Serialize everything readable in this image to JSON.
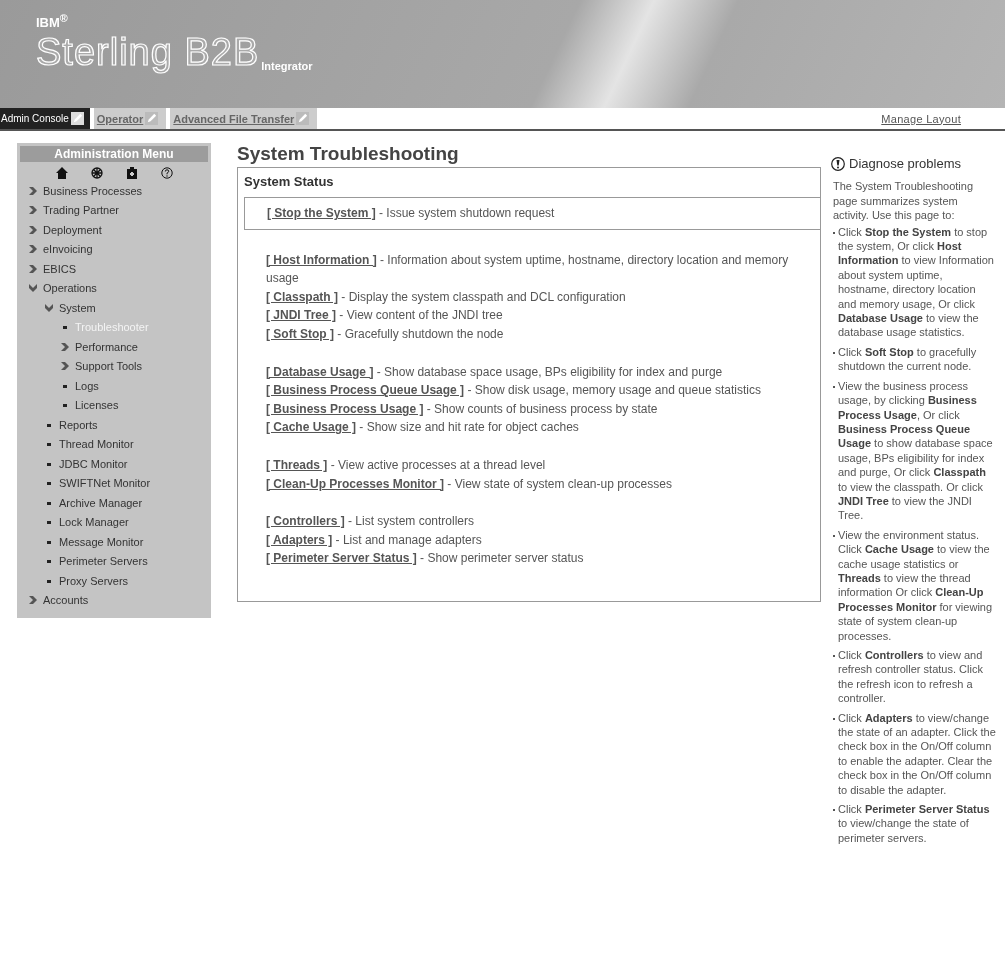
{
  "header": {
    "company": "IBM$^{®}$",
    "product": "Sterling B2B",
    "subtitle": "Integrator"
  },
  "tabs": [
    {
      "label": "Admin Console",
      "selected": true
    },
    {
      "label": "Operator",
      "selected": false
    },
    {
      "label": "Advanced File Transfer",
      "selected": false
    }
  ],
  "manage_layout": "Manage Layout",
  "sidebar": {
    "title": "Administration Menu",
    "items": [
      {
        "label": "Business Processes",
        "kind": "folder",
        "expanded": false,
        "selected": false
      },
      {
        "label": "Trading Partner",
        "kind": "folder",
        "expanded": false,
        "selected": false
      },
      {
        "label": "Deployment",
        "kind": "folder",
        "expanded": false,
        "selected": false
      },
      {
        "label": "eInvoicing",
        "kind": "folder",
        "expanded": false,
        "selected": false
      },
      {
        "label": "EBICS",
        "kind": "folder",
        "expanded": false,
        "selected": false
      },
      {
        "label": "Operations",
        "kind": "folder",
        "expanded": true,
        "selected": false,
        "children": [
          {
            "label": "System",
            "kind": "folder",
            "expanded": true,
            "selected": false,
            "children": [
              {
                "label": "Troubleshooter",
                "kind": "leaf",
                "selected": true
              },
              {
                "label": "Performance",
                "kind": "folder",
                "expanded": false,
                "selected": false
              },
              {
                "label": "Support Tools",
                "kind": "folder",
                "expanded": false,
                "selected": false
              },
              {
                "label": "Logs",
                "kind": "leaf",
                "selected": false
              },
              {
                "label": "Licenses",
                "kind": "leaf",
                "selected": false
              }
            ]
          },
          {
            "label": "Reports",
            "kind": "leaf",
            "selected": false
          },
          {
            "label": "Thread Monitor",
            "kind": "leaf",
            "selected": false
          },
          {
            "label": "JDBC Monitor",
            "kind": "leaf",
            "selected": false
          },
          {
            "label": "SWIFTNet Monitor",
            "kind": "leaf",
            "selected": false
          },
          {
            "label": "Archive Manager",
            "kind": "leaf",
            "selected": false
          },
          {
            "label": "Lock Manager",
            "kind": "leaf",
            "selected": false
          },
          {
            "label": "Message Monitor",
            "kind": "leaf",
            "selected": false
          },
          {
            "label": "Perimeter Servers",
            "kind": "leaf",
            "selected": false
          },
          {
            "label": "Proxy Servers",
            "kind": "leaf",
            "selected": false
          }
        ]
      },
      {
        "label": "Accounts",
        "kind": "folder",
        "expanded": false,
        "selected": false
      }
    ]
  },
  "page_title": "System Troubleshooting",
  "panel": {
    "title": "System Status",
    "groups": [
      {
        "framed": true,
        "links": [
          {
            "link": "[ Stop the System ]",
            "text": "- Issue system shutdown request"
          }
        ]
      },
      {
        "framed": false,
        "links": [
          {
            "link": "[ Host Information ]",
            "text": "- Information about system uptime, hostname, directory location and memory usage"
          },
          {
            "link": "[ Classpath ]",
            "text": "- Display the system classpath and DCL configuration"
          },
          {
            "link": "[ JNDI Tree ]",
            "text": "- View content of the JNDI tree"
          },
          {
            "link": "[ Soft Stop ]",
            "text": "- Gracefully shutdown the node"
          }
        ]
      },
      {
        "framed": false,
        "links": [
          {
            "link": "[ Database Usage ]",
            "text": "- Show database space usage, BPs eligibility for index and purge"
          },
          {
            "link": "[ Business Process Queue Usage ]",
            "text": "- Show disk usage, memory usage and queue statistics"
          },
          {
            "link": "[ Business Process Usage ]",
            "text": "- Show counts of business process by state"
          },
          {
            "link": "[ Cache Usage ]",
            "text": "- Show size and hit rate for object caches"
          }
        ]
      },
      {
        "framed": false,
        "links": [
          {
            "link": "[ Threads ]",
            "text": "- View active processes at a thread level"
          },
          {
            "link": "[ Clean-Up Processes Monitor ]",
            "text": "- View state of system clean-up processes"
          }
        ]
      },
      {
        "framed": false,
        "links": [
          {
            "link": "[ Controllers ]",
            "text": "- List system controllers"
          },
          {
            "link": "[ Adapters ]",
            "text": "- List and manage adapters"
          },
          {
            "link": "[ Perimeter Server Status ]",
            "text": "- Show perimeter server status"
          }
        ]
      }
    ]
  },
  "help": {
    "title": "Diagnose problems",
    "intro": "The System Troubleshooting page summarizes system activity. Use this page to:",
    "bullets": [
      "Click **Stop the System** to stop the system, Or click **Host Information** to view Information about system uptime, hostname, directory location and memory usage, Or click **Database Usage** to view the database usage statistics.",
      "Click **Soft Stop** to gracefully shutdown the current node.",
      "View the business process usage, by clicking **Business Process Usage**, Or click **Business Process Queue Usage** to show database space usage, BPs eligibility for index and purge, Or click **Classpath** to view the classpath. Or click **JNDI Tree** to view the JNDI Tree.",
      "View the environment status. Click **Cache Usage** to view the cache usage statistics or **Threads** to view the thread information Or click **Clean-Up Processes Monitor** for viewing state of system clean-up processes.",
      "Click **Controllers** to view and refresh controller status. Click the refresh icon to refresh a controller.",
      "Click **Adapters** to view/change the state of an adapter. Click the check box in the On/Off column to enable the adapter. Clear the check box in the On/Off column to disable the adapter.",
      "Click **Perimeter Server Status** to view/change the state of perimeter servers."
    ]
  }
}
